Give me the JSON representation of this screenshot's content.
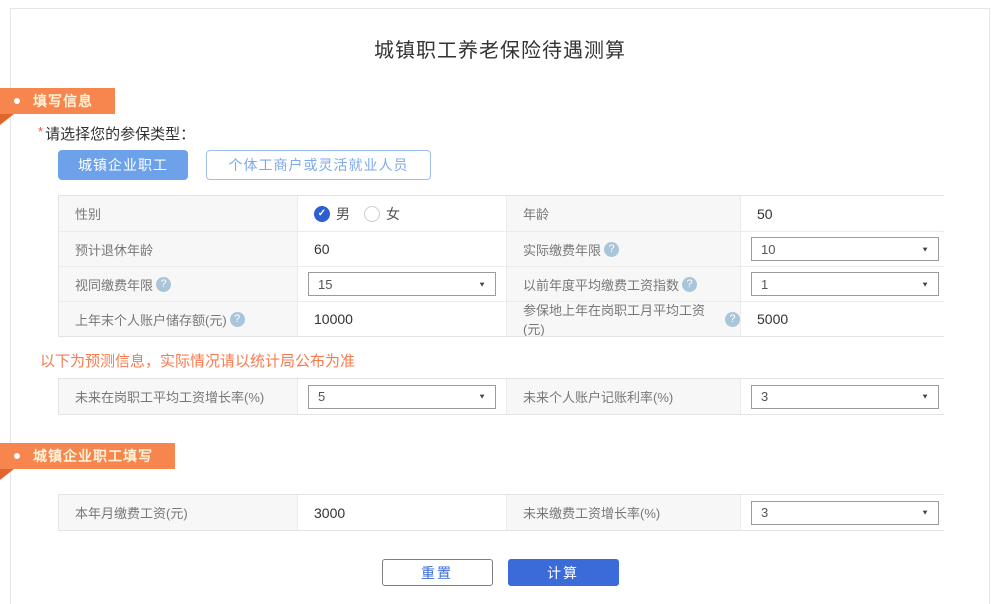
{
  "title": "城镇职工养老保险待遇测算",
  "icons": {
    "bullet": "•",
    "help": "?",
    "dropdown_arrow": "▼",
    "radio_check": "✓"
  },
  "colors": {
    "accent_orange": "#F6854E",
    "ribbon_fold": "#E0662E",
    "accent_blue": "#3A6BD9",
    "selected_type_blue": "#6DA2EA",
    "notice_orange": "#F97A4E",
    "radio_blue": "#2D5FD3"
  },
  "section_fill": {
    "badge": "填写信息"
  },
  "section_company": {
    "badge": "城镇企业职工填写"
  },
  "insured_type": {
    "required_mark": "*",
    "label": "请选择您的参保类型：",
    "options": [
      {
        "label": "城镇企业职工"
      },
      {
        "label": "个体工商户或灵活就业人员"
      }
    ],
    "selected": "城镇企业职工"
  },
  "form": {
    "gender_label": "性别",
    "gender_options": [
      {
        "label": "男"
      },
      {
        "label": "女"
      }
    ],
    "gender_selected": "男",
    "age_label": "年龄",
    "age_value": "50",
    "retire_age_label": "预计退休年龄",
    "retire_age_value": "60",
    "actual_years_label": "实际缴费年限",
    "actual_years_value": "10",
    "deemed_years_label": "视同缴费年限",
    "deemed_years_value": "15",
    "wage_index_label": "以前年度平均缴费工资指数",
    "wage_index_value": "1",
    "balance_label": "上年末个人账户储存额(元)",
    "balance_value": "10000",
    "avg_wage_label": "参保地上年在岗职工月平均工资(元)",
    "avg_wage_value": "5000"
  },
  "notice": "以下为预测信息，实际情况请以统计局公布为准",
  "forecast": {
    "wage_growth_label": "未来在岗职工平均工资增长率(%)",
    "wage_growth_value": "5",
    "account_rate_label": "未来个人账户记账利率(%)",
    "account_rate_value": "3"
  },
  "company": {
    "monthly_wage_label": "本年月缴费工资(元)",
    "monthly_wage_value": "3000",
    "future_growth_label": "未来缴费工资增长率(%)",
    "future_growth_value": "3"
  },
  "actions": {
    "reset": "重置",
    "calculate": "计算"
  }
}
